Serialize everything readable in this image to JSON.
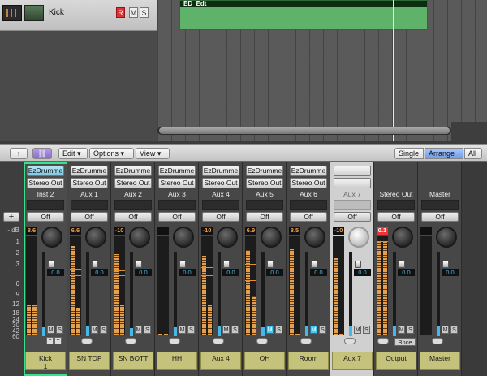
{
  "arrange": {
    "track_name": "Kick",
    "record_label": "R",
    "mute_label": "M",
    "solo_label": "S",
    "region_title": "ED_Edt"
  },
  "toolbar": {
    "up_label": "↑",
    "link_label": "⛓",
    "edit_label": "Edit ▾",
    "options_label": "Options ▾",
    "view_label": "View ▾",
    "single_label": "Single",
    "arrange_label": "Arrange",
    "all_label": "All"
  },
  "scale": {
    "plus_label": "+",
    "marks": [
      "- dB",
      "1",
      "2",
      "3",
      "6",
      "9",
      "12",
      "18",
      "24",
      "30",
      "42",
      "60"
    ]
  },
  "strips": [
    {
      "insert": "EzDrumme",
      "output": "Stereo Out",
      "bus": "Inst 2",
      "off": "Off",
      "peak": "8.6",
      "volume": "0.0",
      "name": "Kick",
      "number": "1",
      "m": "M",
      "s": "S"
    },
    {
      "insert": "EzDrumme",
      "output": "Stereo Out",
      "bus": "Aux 1",
      "off": "Off",
      "peak": "6.6",
      "volume": "0.0",
      "name": "SN TOP",
      "number": "",
      "m": "M",
      "s": "S"
    },
    {
      "insert": "EzDrumme",
      "output": "Stereo Out",
      "bus": "Aux 2",
      "off": "Off",
      "peak": "-10",
      "volume": "0.0",
      "name": "SN BOTT",
      "number": "",
      "m": "M",
      "s": "S"
    },
    {
      "insert": "EzDrumme",
      "output": "Stereo Out",
      "bus": "Aux 3",
      "off": "Off",
      "peak": "",
      "volume": "0.0",
      "name": "HH",
      "number": "",
      "m": "M",
      "s": "S"
    },
    {
      "insert": "EzDrumme",
      "output": "Stereo Out",
      "bus": "Aux 4",
      "off": "Off",
      "peak": "-10",
      "volume": "0.0",
      "name": "Aux 4",
      "number": "",
      "m": "M",
      "s": "S"
    },
    {
      "insert": "EzDrumme",
      "output": "Stereo Out",
      "bus": "Aux 5",
      "off": "Off",
      "peak": "6.9",
      "volume": "0.0",
      "name": "OH",
      "number": "",
      "m": "M",
      "s": "S"
    },
    {
      "insert": "EzDrumme",
      "output": "Stereo Out",
      "bus": "Aux 6",
      "off": "Off",
      "peak": "8.5",
      "volume": "0.0",
      "name": "Room",
      "number": "",
      "m": "M",
      "s": "S"
    },
    {
      "insert": "",
      "output": "",
      "bus": "Aux 7",
      "off": "Off",
      "peak": "-10",
      "volume": "0.0",
      "name": "Aux 7",
      "number": "",
      "m": "M",
      "s": "S"
    },
    {
      "insert": "",
      "output": "",
      "bus": "Stereo Out",
      "off": "Off",
      "peak": "0.1",
      "volume": "0.0",
      "name": "Output",
      "number": "",
      "m": "M",
      "s": "S",
      "bnce": "Bnce"
    },
    {
      "insert": "",
      "output": "",
      "bus": "Master",
      "off": "Off",
      "peak": "",
      "volume": "0.0",
      "name": "Master",
      "number": "",
      "m": "M",
      "s": "S"
    }
  ],
  "colors": {
    "accent": "#3ae08a",
    "fader": "#46b8e8",
    "label": "#c5c27c",
    "meter": "#e6a04c",
    "peak_red": "#e33333"
  }
}
